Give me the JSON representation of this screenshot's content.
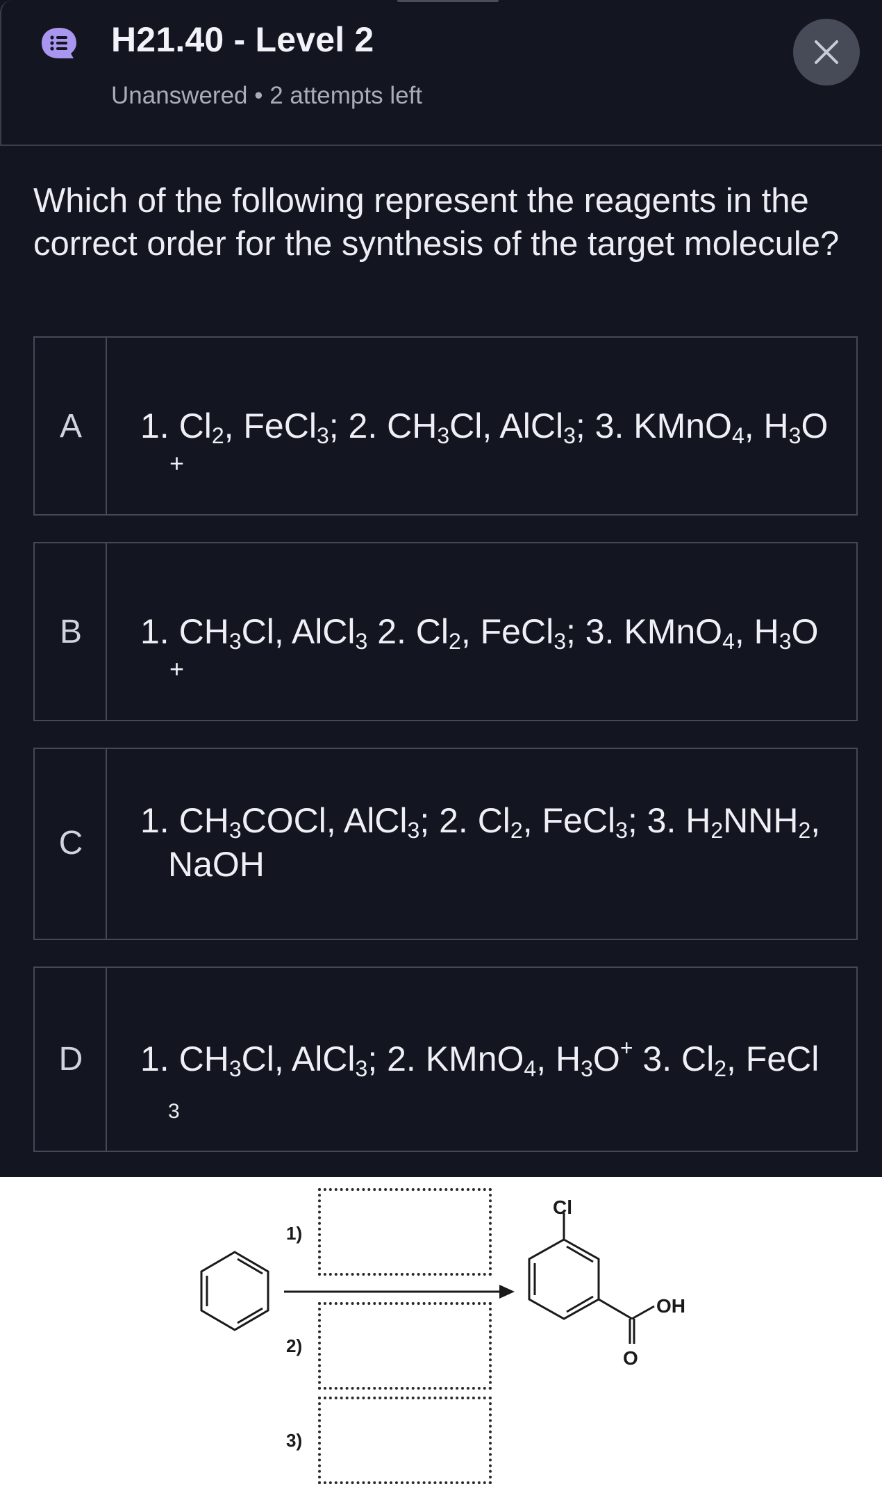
{
  "header": {
    "title": "H21.40 - Level 2",
    "subtitle": "Unanswered • 2 attempts left",
    "icon": "chat-list-icon",
    "accent": "#a996ef",
    "close_icon": "close-icon"
  },
  "question": {
    "text": "Which of the following represent the reagents in the correct order for the synthesis of the target molecule?"
  },
  "options": [
    {
      "letter": "A",
      "t1": "1. Cl",
      "t2": "2",
      "t3": ", FeCl",
      "t4": "3",
      "t5": "; 2. CH",
      "t6": "3",
      "t7": "Cl, AlCl",
      "t8": "3",
      "t9": "; 3. KMnO",
      "t10": "4",
      "t11": ", H",
      "t12": "3",
      "t13": "O",
      "stray": "+"
    },
    {
      "letter": "B",
      "t1": "1. CH",
      "t2": "3",
      "t3": "Cl, AlCl",
      "t4": "3",
      "t5": " 2. Cl",
      "t6": "2",
      "t7": ", FeCl",
      "t8": "3",
      "t9": "; 3. KMnO",
      "t10": "4",
      "t11": ", H",
      "t12": "3",
      "t13": "O",
      "stray": "+"
    },
    {
      "letter": "C",
      "t1": "1. CH",
      "t2": "3",
      "t3": "COCl, AlCl",
      "t4": "3",
      "t5": "; 2. Cl",
      "t6": "2",
      "t7": ", FeCl",
      "t8": "3",
      "t9": "; 3. H",
      "t10": "2",
      "t11": "NNH",
      "t12": "2",
      "t13": ",",
      "line2": "NaOH"
    },
    {
      "letter": "D",
      "t1": "1. CH",
      "t2": "3",
      "t3": "Cl, AlCl",
      "t4": "3",
      "t5": "; 2. KMnO",
      "t6": "4",
      "t7": ", H",
      "t8": "3",
      "t9": "O",
      "t10": "+",
      "t11": " 3. Cl",
      "t12": "2",
      "t13": ", FeCl",
      "stray": "3"
    }
  ],
  "scheme": {
    "step1": "1)",
    "step2": "2)",
    "step3": "3)",
    "label_cl": "Cl",
    "label_oh": "OH",
    "label_o": "O"
  }
}
